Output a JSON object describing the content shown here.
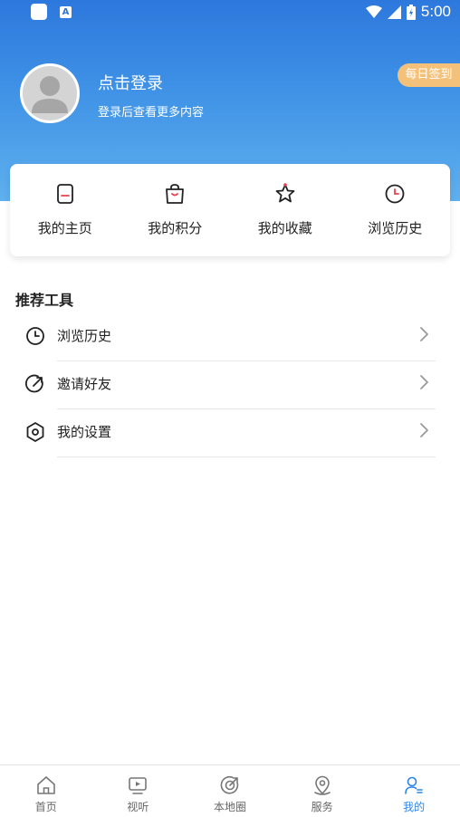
{
  "status_bar": {
    "time": "5:00"
  },
  "profile": {
    "login_title": "点击登录",
    "login_subtitle": "登录后查看更多内容",
    "checkin_label": "每日签到"
  },
  "quick_actions": [
    {
      "label": "我的主页",
      "icon": "homepage-icon"
    },
    {
      "label": "我的积分",
      "icon": "shopping-bag-icon"
    },
    {
      "label": "我的收藏",
      "icon": "star-icon"
    },
    {
      "label": "浏览历史",
      "icon": "clock-icon"
    }
  ],
  "tools": {
    "title": "推荐工具",
    "items": [
      {
        "label": "浏览历史",
        "icon": "clock-icon"
      },
      {
        "label": "邀请好友",
        "icon": "share-arrow-icon"
      },
      {
        "label": "我的设置",
        "icon": "hexagon-settings-icon"
      }
    ]
  },
  "bottom_nav": [
    {
      "label": "首页",
      "icon": "home-icon",
      "active": false
    },
    {
      "label": "视听",
      "icon": "video-icon",
      "active": false
    },
    {
      "label": "本地圈",
      "icon": "local-circle-icon",
      "active": false
    },
    {
      "label": "服务",
      "icon": "location-pin-icon",
      "active": false
    },
    {
      "label": "我的",
      "icon": "profile-icon",
      "active": true
    }
  ],
  "colors": {
    "header_blue": "#2d78dd",
    "checkin_orange": "#f4c17a",
    "active_tab": "#2d86e3",
    "accent_red": "#e8404c"
  }
}
